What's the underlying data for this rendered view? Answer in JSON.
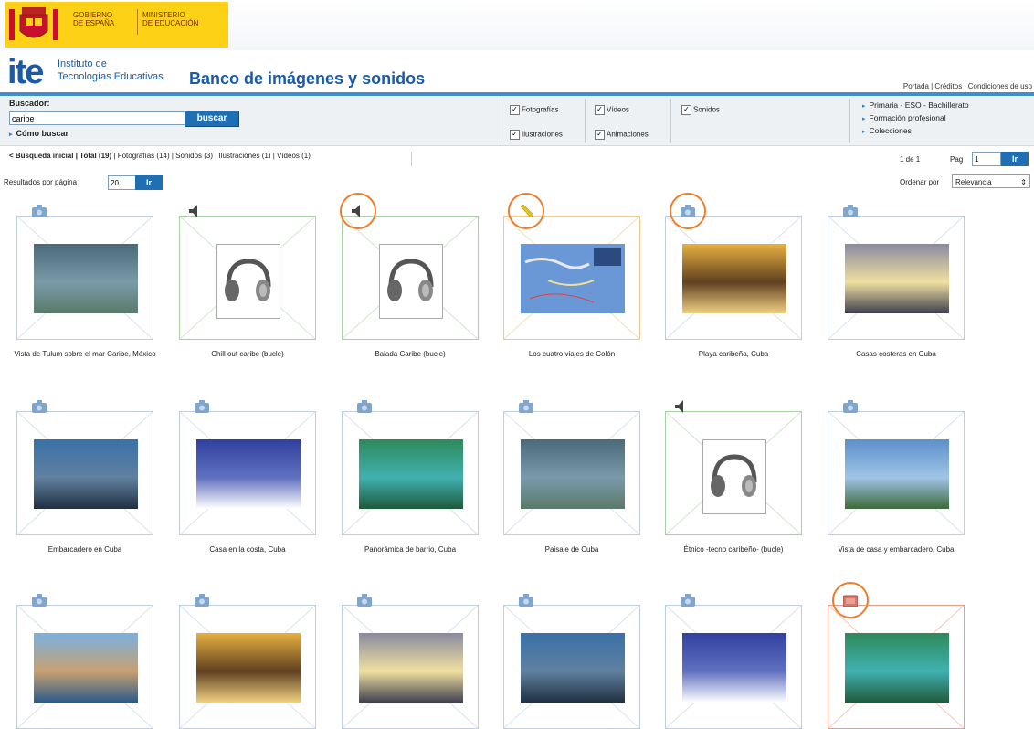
{
  "header": {
    "gov_text_1_line1": "GOBIERNO",
    "gov_text_1_line2": "DE ESPAÑA",
    "gov_text_2_line1": "MINISTERIO",
    "gov_text_2_line2": "DE EDUCACIÓN",
    "ite_big": "ite",
    "ite_sub1": "Instituto de",
    "ite_sub2": "Tecnologías Educativas",
    "site_title": "Banco de imágenes y sonidos",
    "top_links": "Portada | Créditos | Condiciones de uso"
  },
  "search": {
    "label": "Buscador:",
    "value": "caribe",
    "button": "buscar",
    "how": "Cómo buscar"
  },
  "filters": {
    "fotografias": "Fotografías",
    "ilustraciones": "Ilustraciones",
    "videos": "Vídeos",
    "animaciones": "Animaciones",
    "sonidos": "Sonidos"
  },
  "levels": [
    "Primaria - ESO - Bachillerato",
    "Formación profesional",
    "Colecciones"
  ],
  "results": {
    "back": "< Búsqueda inicial",
    "total": "Total (19)",
    "breakdown": "Fotografías (14) | Sonidos (3) | Ilustraciones (1) | Vídeos (1)",
    "page_of": "1 de 1",
    "pag_label": "Pag",
    "pag_value": "1",
    "go": "Ir",
    "per_page_label": "Resultados por página",
    "per_page_value": "20",
    "order_label": "Ordenar por",
    "order_value": "Relevancia"
  },
  "gallery": [
    {
      "caption": "Vista de Tulum sobre el mar Caribe, México",
      "type": "photo",
      "highlight": false
    },
    {
      "caption": "Chill out caribe (bucle)",
      "type": "sound",
      "highlight": false
    },
    {
      "caption": "Balada Caribe (bucle)",
      "type": "sound",
      "highlight": true
    },
    {
      "caption": "Los cuatro viajes de Colón",
      "type": "illustration",
      "highlight": true
    },
    {
      "caption": "Playa caribeña, Cuba",
      "type": "photo",
      "highlight": true
    },
    {
      "caption": "Casas costeras en Cuba",
      "type": "photo",
      "highlight": false
    },
    {
      "caption": "Embarcadero en Cuba",
      "type": "photo",
      "highlight": false
    },
    {
      "caption": "Casa en la costa, Cuba",
      "type": "photo",
      "highlight": false
    },
    {
      "caption": "Panorámica de barrio, Cuba",
      "type": "photo",
      "highlight": false
    },
    {
      "caption": "Paisaje de Cuba",
      "type": "photo",
      "highlight": false
    },
    {
      "caption": "Étnico -tecno caribeño- (bucle)",
      "type": "sound",
      "highlight": false
    },
    {
      "caption": "Vista de casa y embarcadero, Cuba",
      "type": "photo",
      "highlight": false
    },
    {
      "caption": "",
      "type": "photo",
      "highlight": false
    },
    {
      "caption": "",
      "type": "photo",
      "highlight": false
    },
    {
      "caption": "",
      "type": "photo",
      "highlight": false
    },
    {
      "caption": "",
      "type": "photo",
      "highlight": false
    },
    {
      "caption": "",
      "type": "photo",
      "highlight": false
    },
    {
      "caption": "",
      "type": "video",
      "highlight": true
    }
  ],
  "colors": {
    "brand_blue": "#1a5ba8",
    "button_blue": "#1f6fb5",
    "highlight_orange": "#f07d2a",
    "gov_yellow": "#fcd116"
  }
}
